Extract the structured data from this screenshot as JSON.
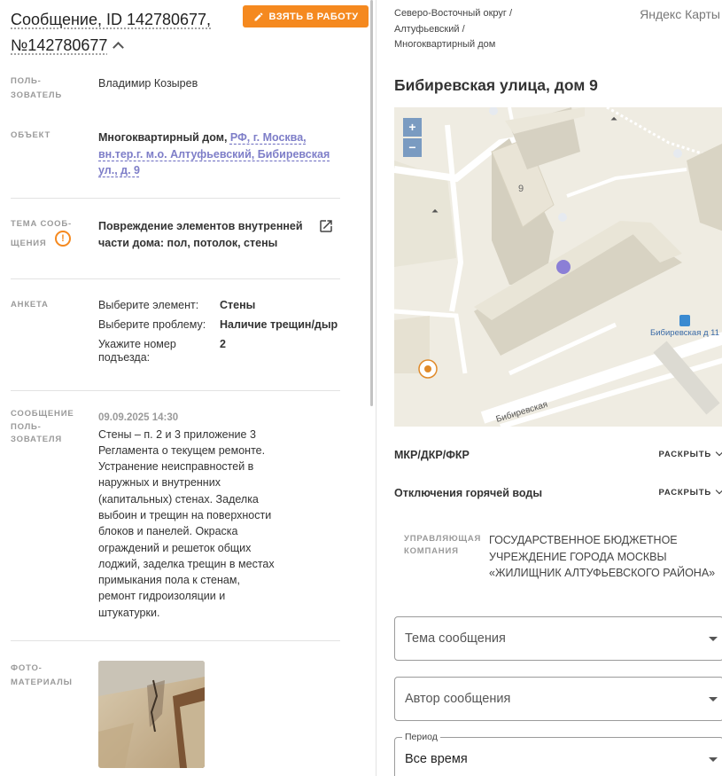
{
  "header": {
    "title": "Сообщение, ID 142780677, №142780677",
    "take_button": "Взять в работу"
  },
  "fields": {
    "user": {
      "label": "Поль-\nзователь",
      "value": "Владимир Козырев"
    },
    "object": {
      "label": "Объект",
      "prefix": "Многоквартирный дом, ",
      "link": "РФ, г. Москва, вн.тер.г. м.о. Алтуфьевский, Бибиревская ул., д. 9"
    },
    "topic": {
      "label": "Тема сооб-\nщения",
      "warning_symbol": "!",
      "value": "Повреждение элементов внутренней части дома: пол, потолок, стены"
    },
    "survey": {
      "label": "Анкета",
      "rows": [
        {
          "q": "Выберите элемент:",
          "a": "Стены"
        },
        {
          "q": "Выберите проблему:",
          "a": "Наличие трещин/дыр"
        },
        {
          "q": "Укажите номер\nподъезда:",
          "a": "2"
        }
      ]
    },
    "message": {
      "label": "Сообщение\nполь-\nзователя",
      "date": "09.09.2025 14:30",
      "text": "Стены – п. 2 и 3 приложение 3 Регламента о текущем ремонте. Устранение неисправностей в наружных и внутренних (капитальных) стенах. Заделка выбоин и трещин на поверхности блоков и панелей. Окраска ограждений и решеток общих лоджий, заделка трещин в местах примыкания пола к стенам, ремонт гидроизоляции и штукатурки."
    },
    "photos": {
      "label": "Фото-\nматериалы"
    }
  },
  "right": {
    "breadcrumb": "Северо-Восточный округ /\nАлтуфьевский /\nМногоквартирный дом",
    "map_provider": "Яндекс Карты",
    "address": "Бибиревская улица, дом 9",
    "map": {
      "zoom_in": "+",
      "zoom_out": "−",
      "house_number": "9",
      "street_label": "Бибиревская",
      "stop_label": "Бибиревская д 11"
    },
    "sections": [
      {
        "title": "МКР/ДКР/ФКР",
        "action": "РАСКРЫТЬ"
      },
      {
        "title": "Отключения горячей воды",
        "action": "РАСКРЫТЬ"
      }
    ],
    "management": {
      "label": "УПРАВЛЯЮЩАЯ\nКОМПАНИЯ",
      "value": "ГОСУДАРСТВЕННОЕ БЮДЖЕТНОЕ УЧРЕЖДЕНИЕ ГОРОДА МОСКВЫ «ЖИЛИЩНИК АЛТУФЬЕВСКОГО РАЙОНА»"
    },
    "filters": {
      "topic": {
        "placeholder": "Тема сообщения"
      },
      "author": {
        "placeholder": "Автор сообщения"
      },
      "period": {
        "legend": "Период",
        "value": "Все время"
      }
    }
  }
}
